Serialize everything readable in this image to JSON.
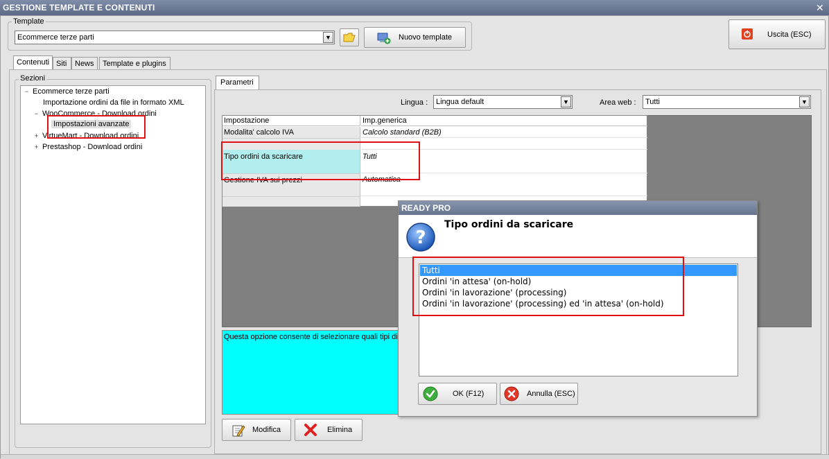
{
  "window": {
    "title": "GESTIONE TEMPLATE E CONTENUTI",
    "close_glyph": "✕"
  },
  "template_group": {
    "legend": "Template",
    "selected": "Ecommerce terze parti",
    "open_folder_icon": "folder-icon",
    "new_button": "Nuovo template"
  },
  "exit_button": "Uscita (ESC)",
  "tabs": [
    {
      "label": "Contenuti",
      "active": true
    },
    {
      "label": "Siti",
      "active": false
    },
    {
      "label": "News",
      "active": false
    },
    {
      "label": "Template e plugins",
      "active": false
    }
  ],
  "sections": {
    "legend": "Sezioni",
    "tree": [
      {
        "label": "Ecommerce terze parti",
        "expander": "−",
        "level": 0
      },
      {
        "label": "Importazione ordini da file in formato XML",
        "expander": "",
        "level": 1
      },
      {
        "label": "WooCommerce - Download ordini",
        "expander": "−",
        "level": 1
      },
      {
        "label": "Impostazioni avanzate",
        "expander": "",
        "level": 2,
        "selected": true
      },
      {
        "label": "VirtueMart - Download ordini",
        "expander": "+",
        "level": 1
      },
      {
        "label": "Prestashop - Download ordini",
        "expander": "+",
        "level": 1
      }
    ]
  },
  "params": {
    "tab_label": "Parametri",
    "lingua_label": "Lingua :",
    "lingua_value": "Lingua default",
    "area_label": "Area web :",
    "area_value": "Tutti",
    "grid_headers": [
      "Impostazione",
      "Imp.generica"
    ],
    "grid_rows": [
      {
        "setting": "Modalita' calcolo IVA",
        "value": "Calcolo standard (B2B)"
      },
      {
        "setting": "",
        "value": ""
      },
      {
        "setting": "Tipo ordini da scaricare",
        "value": "Tutti"
      },
      {
        "setting": "Gestione IVA sui prezzi",
        "value": "Automatica"
      },
      {
        "setting": "",
        "value": ""
      }
    ],
    "description": "Questa opzione consente di selezionare quali tipi di o",
    "edit_button": "Modifica",
    "delete_button": "Elimina"
  },
  "dialog": {
    "title": "READY PRO",
    "heading": "Tipo ordini da scaricare",
    "options": [
      "Tutti",
      "Ordini 'in attesa' (on-hold)",
      "Ordini 'in lavorazione' (processing)",
      "Ordini 'in lavorazione' (processing) ed 'in attesa' (on-hold)"
    ],
    "selected_index": 0,
    "ok_button": "OK (F12)",
    "cancel_button": "Annulla (ESC)"
  },
  "colors": {
    "selection": "#3399ff",
    "highlight_row": "#b3eeee",
    "description_bg": "#00ffff",
    "annotation": "#e01010"
  }
}
